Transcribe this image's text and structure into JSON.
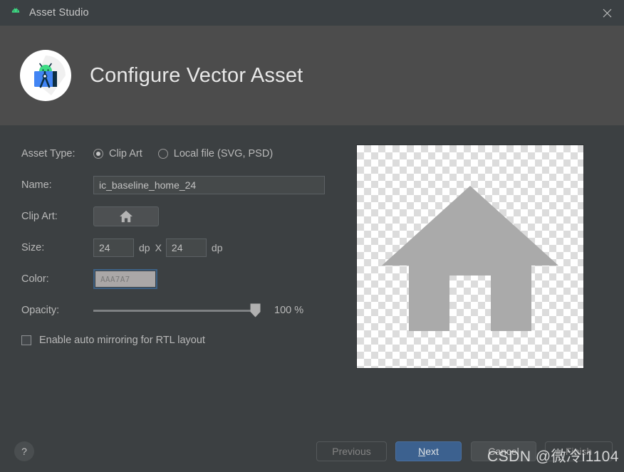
{
  "window": {
    "title": "Asset Studio",
    "app_icon": "android-robot-icon",
    "close_label": "×"
  },
  "header": {
    "title": "Configure Vector Asset",
    "logo": "android-studio-logo"
  },
  "form": {
    "asset_type": {
      "label": "Asset Type:",
      "options": [
        {
          "label": "Clip Art",
          "selected": true
        },
        {
          "label": "Local file (SVG, PSD)",
          "selected": false
        }
      ]
    },
    "name": {
      "label": "Name:",
      "value": "ic_baseline_home_24",
      "placeholder": "Name"
    },
    "clip_art": {
      "label": "Clip Art:",
      "icon": "home-icon"
    },
    "size": {
      "label": "Size:",
      "width": "24",
      "height": "24",
      "unit_width": "dp",
      "unit_height": "dp",
      "separator": "X"
    },
    "color": {
      "label": "Color:",
      "value": "AAA7A7",
      "swatch_hex": "#AAA7A7",
      "focus_hex": "#3D6185"
    },
    "opacity": {
      "label": "Opacity:",
      "value": "100 %",
      "percent": 100
    },
    "mirroring": {
      "label": "Enable auto mirroring for RTL layout",
      "checked": false
    }
  },
  "preview": {
    "icon": "home-icon",
    "icon_color": "#AAAAAA",
    "background": "transparency-checkerboard"
  },
  "footer": {
    "help_label": "?",
    "buttons": [
      {
        "label": "Previous",
        "state": "disabled"
      },
      {
        "label": "Next",
        "state": "default",
        "mnemonic": "N"
      },
      {
        "label": "Cancel",
        "state": "normal"
      },
      {
        "label": "Finish",
        "state": "disabled"
      }
    ]
  },
  "watermark": {
    "text": "CSDN @微冷i1104"
  }
}
